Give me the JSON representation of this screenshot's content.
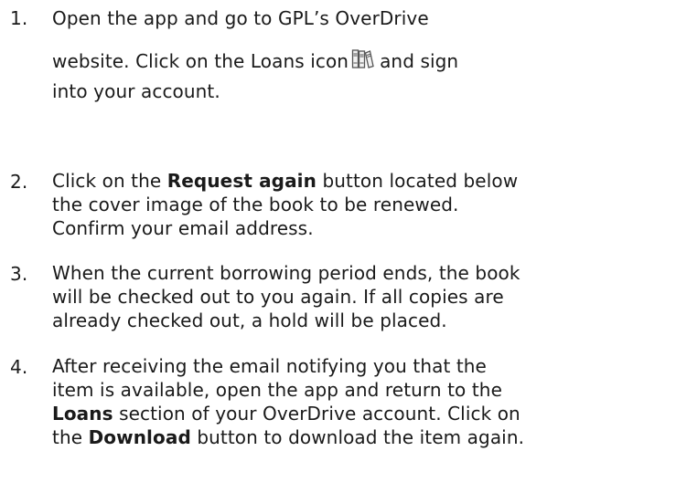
{
  "steps": [
    {
      "number": "1.",
      "line1": "Open the app and go to GPL’s OverDrive",
      "line2_before": "website. Click on the Loans icon",
      "line2_after": "and sign",
      "line3": "into your account.",
      "icon": "loans-books-icon"
    },
    {
      "number": "2.",
      "line1_prefix": "Click on the ",
      "line1_bold": "Request again",
      "line1_suffix": " button located below",
      "line2": "the cover image of the book to be renewed.",
      "line3": "Confirm your email address."
    },
    {
      "number": "3.",
      "line1": "When the current borrowing period ends, the book",
      "line2": "will be checked out to you again. If all copies are",
      "line3": "already checked out, a hold will be placed."
    },
    {
      "number": "4.",
      "line1": "After receiving the email notifying you that the",
      "line2": "item is available, open the app and return to the",
      "line3_bold": "Loans",
      "line3_suffix": " section of your OverDrive account. Click on",
      "line4_prefix": "the ",
      "line4_bold": "Download",
      "line4_suffix": " button to download the item again."
    }
  ]
}
